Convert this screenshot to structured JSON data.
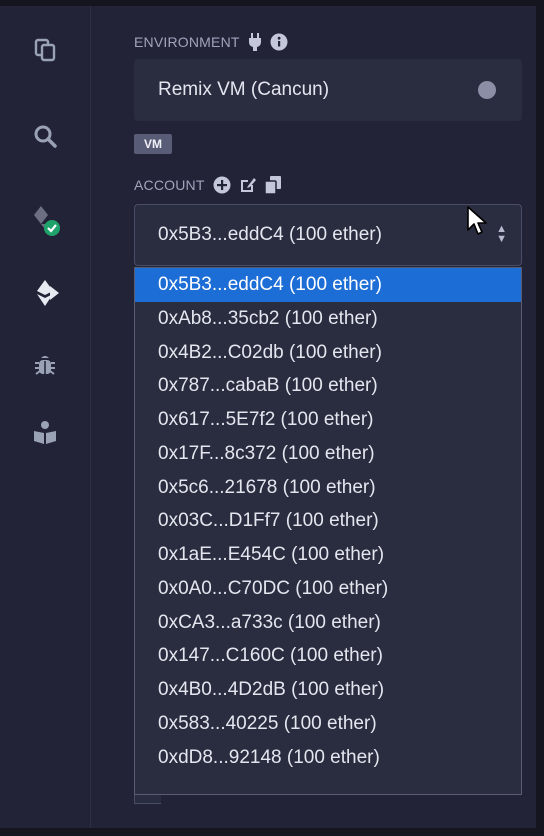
{
  "environment": {
    "label": "ENVIRONMENT",
    "selected": "Remix VM (Cancun)",
    "badge": "VM"
  },
  "account": {
    "label": "ACCOUNT",
    "selected": "0x5B3...eddC4 (100 ether)",
    "options": [
      "0x5B3...eddC4 (100 ether)",
      "0xAb8...35cb2 (100 ether)",
      "0x4B2...C02db (100 ether)",
      "0x787...cabaB (100 ether)",
      "0x617...5E7f2 (100 ether)",
      "0x17F...8c372 (100 ether)",
      "0x5c6...21678 (100 ether)",
      "0x03C...D1Ff7 (100 ether)",
      "0x1aE...E454C (100 ether)",
      "0x0A0...C70DC (100 ether)",
      "0xCA3...a733c (100 ether)",
      "0x147...C160C (100 ether)",
      "0x4B0...4D2dB (100 ether)",
      "0x583...40225 (100 ether)",
      "0xdD8...92148 (100 ether)"
    ],
    "selected_index": 0
  },
  "icons": {
    "sidebar": [
      "file-explorer-icon",
      "search-icon",
      "solidity-compiler-icon",
      "deploy-run-icon",
      "debugger-icon",
      "learneth-icon"
    ],
    "environment_label": [
      "plug-icon",
      "info-icon"
    ],
    "account_label": [
      "add-account-icon",
      "edit-icon",
      "copy-icon"
    ]
  },
  "colors": {
    "background": "#222336",
    "selected_option": "#1c6dd6",
    "success_badge": "#1fa26b"
  }
}
